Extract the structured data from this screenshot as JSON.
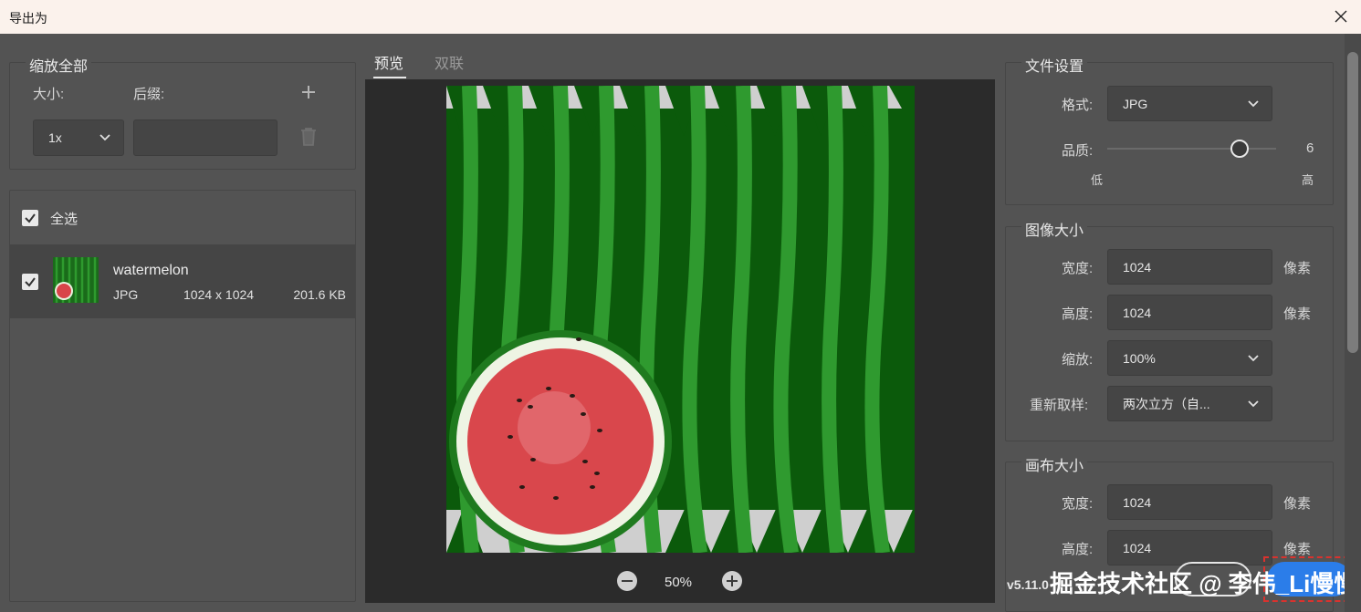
{
  "window": {
    "title": "导出为"
  },
  "scale_all": {
    "legend": "缩放全部",
    "size_label": "大小:",
    "suffix_label": "后缀:",
    "size_value": "1x",
    "suffix_value": "",
    "add_icon": "plus-icon",
    "delete_icon": "trash-icon"
  },
  "assets": {
    "select_all_label": "全选",
    "select_all_checked": true,
    "items": [
      {
        "name": "watermelon",
        "format": "JPG",
        "dimensions": "1024 x 1024",
        "size": "201.6 KB",
        "checked": true
      }
    ]
  },
  "tabs": [
    {
      "label": "预览",
      "active": true
    },
    {
      "label": "双联",
      "active": false
    }
  ],
  "preview": {
    "zoom": "50%"
  },
  "file_settings": {
    "legend": "文件设置",
    "format_label": "格式:",
    "format_value": "JPG",
    "quality_label": "品质:",
    "quality_value": "6",
    "quality_fraction": 0.78,
    "low_label": "低",
    "high_label": "高"
  },
  "image_size": {
    "legend": "图像大小",
    "width_label": "宽度:",
    "width_value": "1024",
    "height_label": "高度:",
    "height_value": "1024",
    "scale_label": "缩放:",
    "scale_value": "100%",
    "resample_label": "重新取样:",
    "resample_value": "两次立方（自...",
    "unit": "像素"
  },
  "canvas_size": {
    "legend": "画布大小",
    "width_label": "宽度:",
    "width_value": "1024",
    "height_label": "高度:",
    "height_value": "1024",
    "unit": "像素"
  },
  "version": "v5.11.0",
  "watermark_text": "掘金技术社区 @ 李伟_Li慢慢",
  "colors": {
    "background": "#535353",
    "titlebar": "#fbf2ec",
    "preview_bg": "#2b2b2b",
    "accent": "#2b7de9"
  }
}
